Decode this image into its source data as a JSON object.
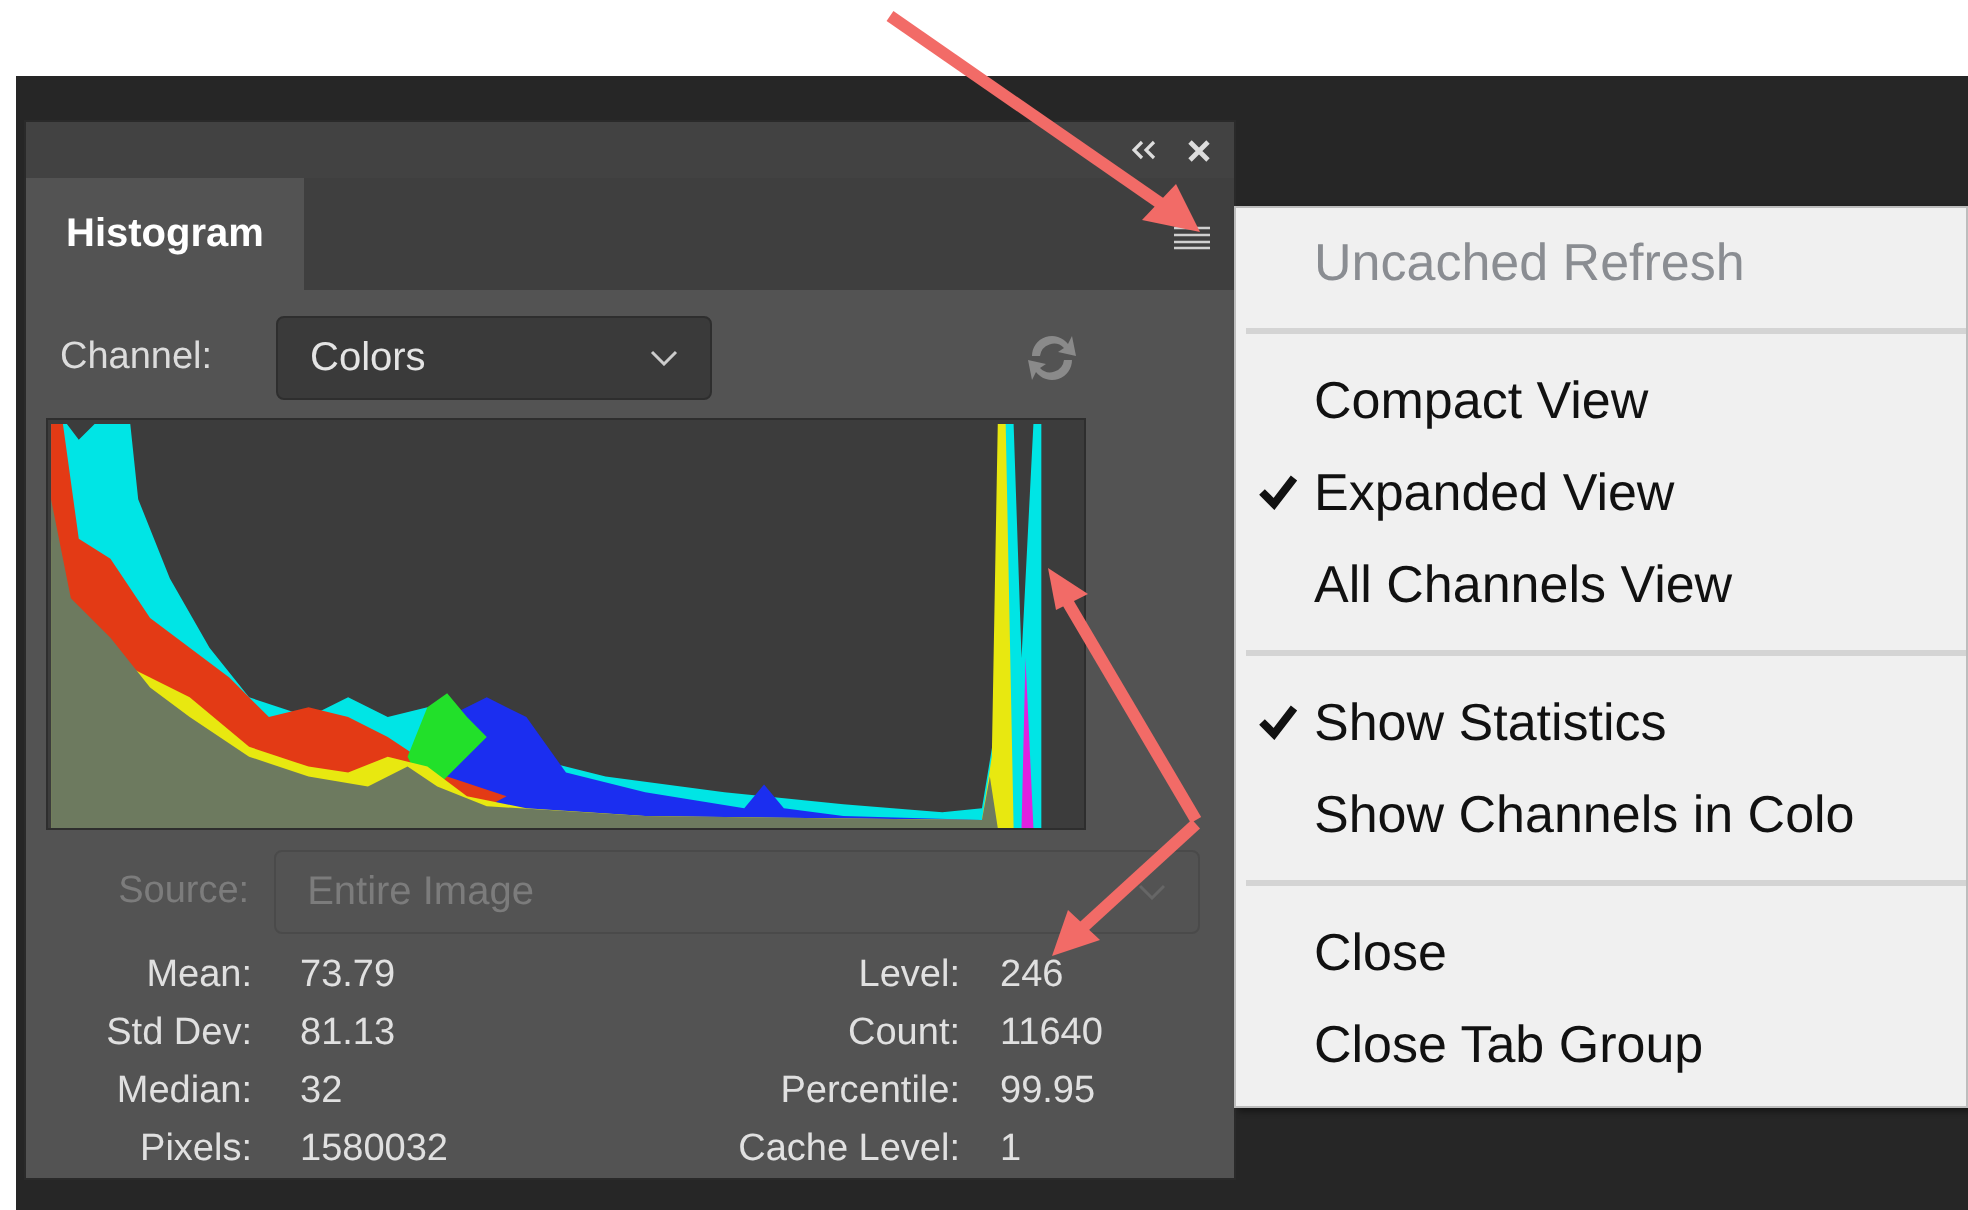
{
  "panel": {
    "tab": {
      "label": "Histogram",
      "selected": true
    },
    "channel": {
      "label": "Channel:",
      "value": "Colors"
    },
    "source": {
      "label": "Source:",
      "value": "Entire Image",
      "disabled": true
    },
    "stats_left": [
      {
        "label": "Mean:",
        "value": "73.79"
      },
      {
        "label": "Std Dev:",
        "value": "81.13"
      },
      {
        "label": "Median:",
        "value": "32"
      },
      {
        "label": "Pixels:",
        "value": "1580032"
      }
    ],
    "stats_right": [
      {
        "label": "Level:",
        "value": "246"
      },
      {
        "label": "Count:",
        "value": "11640"
      },
      {
        "label": "Percentile:",
        "value": "99.95"
      },
      {
        "label": "Cache Level:",
        "value": "1"
      }
    ]
  },
  "menu": {
    "groups": [
      [
        {
          "label": "Uncached Refresh",
          "checked": false,
          "disabled": true
        }
      ],
      [
        {
          "label": "Compact View",
          "checked": false,
          "disabled": false
        },
        {
          "label": "Expanded View",
          "checked": true,
          "disabled": false
        },
        {
          "label": "All Channels View",
          "checked": false,
          "disabled": false
        }
      ],
      [
        {
          "label": "Show Statistics",
          "checked": true,
          "disabled": false
        },
        {
          "label": "Show Channels in Colo",
          "checked": false,
          "disabled": false
        }
      ],
      [
        {
          "label": "Close",
          "checked": false,
          "disabled": false
        },
        {
          "label": "Close Tab Group",
          "checked": false,
          "disabled": false
        }
      ]
    ]
  }
}
